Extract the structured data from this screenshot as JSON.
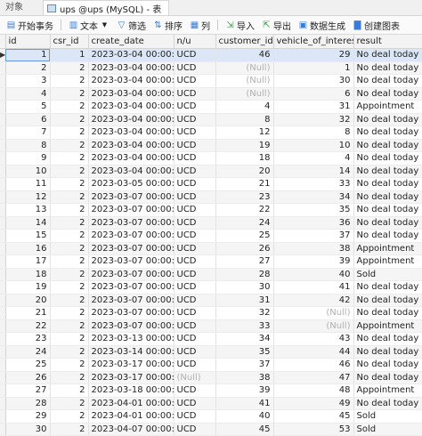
{
  "tabs": {
    "objects_label": "对象",
    "table_tab_label": "ups @ups (MySQL) - 表"
  },
  "toolbar": {
    "begin_tx": "开始事务",
    "text": "文本",
    "filter": "筛选",
    "sort": "排序",
    "columns": "列",
    "import": "导入",
    "export": "导出",
    "gen_data": "数据生成",
    "create_chart": "创建图表"
  },
  "columns": [
    "id",
    "csr_id",
    "create_date",
    "n/u",
    "customer_id",
    "vehicle_of_interest",
    "result"
  ],
  "null_text": "(Null)",
  "rows": [
    [
      "1",
      "1",
      "2023-03-04 00:00:00",
      "UCD",
      "46",
      "29",
      "No deal today"
    ],
    [
      "2",
      "2",
      "2023-03-04 00:00:00",
      "UCD",
      "(Null)",
      "1",
      "No deal today"
    ],
    [
      "3",
      "2",
      "2023-03-04 00:00:00",
      "UCD",
      "(Null)",
      "30",
      "No deal today"
    ],
    [
      "4",
      "2",
      "2023-03-04 00:00:00",
      "UCD",
      "(Null)",
      "6",
      "No deal today"
    ],
    [
      "5",
      "2",
      "2023-03-04 00:00:00",
      "UCD",
      "4",
      "31",
      "Appointment"
    ],
    [
      "6",
      "2",
      "2023-03-04 00:00:00",
      "UCD",
      "8",
      "32",
      "No deal today"
    ],
    [
      "7",
      "2",
      "2023-03-04 00:00:00",
      "UCD",
      "12",
      "8",
      "No deal today"
    ],
    [
      "8",
      "2",
      "2023-03-04 00:00:00",
      "UCD",
      "19",
      "10",
      "No deal today"
    ],
    [
      "9",
      "2",
      "2023-03-04 00:00:00",
      "UCD",
      "18",
      "4",
      "No deal today"
    ],
    [
      "10",
      "2",
      "2023-03-04 00:00:00",
      "UCD",
      "20",
      "14",
      "No deal today"
    ],
    [
      "11",
      "2",
      "2023-03-05 00:00:00",
      "UCD",
      "21",
      "33",
      "No deal today"
    ],
    [
      "12",
      "2",
      "2023-03-07 00:00:00",
      "UCD",
      "23",
      "34",
      "No deal today"
    ],
    [
      "13",
      "2",
      "2023-03-07 00:00:00",
      "UCD",
      "22",
      "35",
      "No deal today"
    ],
    [
      "14",
      "2",
      "2023-03-07 00:00:00",
      "UCD",
      "24",
      "36",
      "No deal today"
    ],
    [
      "15",
      "2",
      "2023-03-07 00:00:00",
      "UCD",
      "25",
      "37",
      "No deal today"
    ],
    [
      "16",
      "2",
      "2023-03-07 00:00:00",
      "UCD",
      "26",
      "38",
      "Appointment"
    ],
    [
      "17",
      "2",
      "2023-03-07 00:00:00",
      "UCD",
      "27",
      "39",
      "Appointment"
    ],
    [
      "18",
      "2",
      "2023-03-07 00:00:00",
      "UCD",
      "28",
      "40",
      "Sold"
    ],
    [
      "19",
      "2",
      "2023-03-07 00:00:00",
      "UCD",
      "30",
      "41",
      "No deal today"
    ],
    [
      "20",
      "2",
      "2023-03-07 00:00:00",
      "UCD",
      "31",
      "42",
      "No deal today"
    ],
    [
      "21",
      "2",
      "2023-03-07 00:00:00",
      "UCD",
      "32",
      "(Null)",
      "No deal today"
    ],
    [
      "22",
      "2",
      "2023-03-07 00:00:00",
      "UCD",
      "33",
      "(Null)",
      "Appointment"
    ],
    [
      "23",
      "2",
      "2023-03-13 00:00:00",
      "UCD",
      "34",
      "43",
      "No deal today"
    ],
    [
      "24",
      "2",
      "2023-03-14 00:00:00",
      "UCD",
      "35",
      "44",
      "No deal today"
    ],
    [
      "25",
      "2",
      "2023-03-17 00:00:00",
      "UCD",
      "37",
      "46",
      "No deal today"
    ],
    [
      "26",
      "2",
      "2023-03-17 00:00:00",
      "(Null)",
      "38",
      "47",
      "No deal today"
    ],
    [
      "27",
      "2",
      "2023-03-18 00:00:00",
      "UCD",
      "39",
      "48",
      "Appointment"
    ],
    [
      "28",
      "2",
      "2023-04-01 00:00:00",
      "UCD",
      "41",
      "49",
      "No deal today"
    ],
    [
      "29",
      "2",
      "2023-04-01 00:00:00",
      "UCD",
      "40",
      "45",
      "Sold"
    ],
    [
      "30",
      "2",
      "2023-04-07 00:00:00",
      "UCD",
      "45",
      "53",
      "Sold"
    ]
  ],
  "colors": {
    "selected_row": "#dbe7f6",
    "null_text": "#b0b0b0",
    "accent": "#5b8fc9"
  },
  "icons": {
    "tab": "table-icon",
    "begin_tx": "transaction-icon",
    "text": "text-icon",
    "filter": "filter-icon",
    "sort": "sort-icon",
    "columns": "columns-icon",
    "import": "import-icon",
    "export": "export-icon",
    "gen_data": "data-generation-icon",
    "create_chart": "chart-icon",
    "row_marker": "row-pointer-icon"
  }
}
